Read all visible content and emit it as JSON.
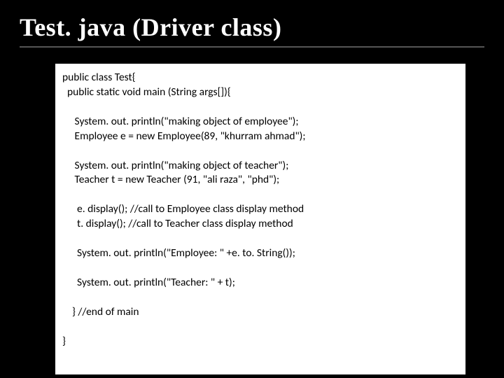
{
  "slide": {
    "title": "Test. java (Driver class)",
    "code": {
      "l1": "public class Test{",
      "l2": "  public static void main (String args[]){",
      "l3": "     System. out. println(\"making object of employee\");",
      "l4": "     Employee e = new Employee(89, \"khurram ahmad\");",
      "l5": "     System. out. println(\"making object of teacher\");",
      "l6": "     Teacher t = new Teacher (91, \"ali raza\", \"phd\");",
      "l7": "      e. display(); //call to Employee class display method",
      "l8": "      t. display(); //call to Teacher class display method",
      "l9": "      System. out. println(\"Employee: \" +e. to. String());",
      "l10": "      System. out. println(\"Teacher: \" + t);",
      "l11": "    } //end of main",
      "l12": "}"
    }
  }
}
